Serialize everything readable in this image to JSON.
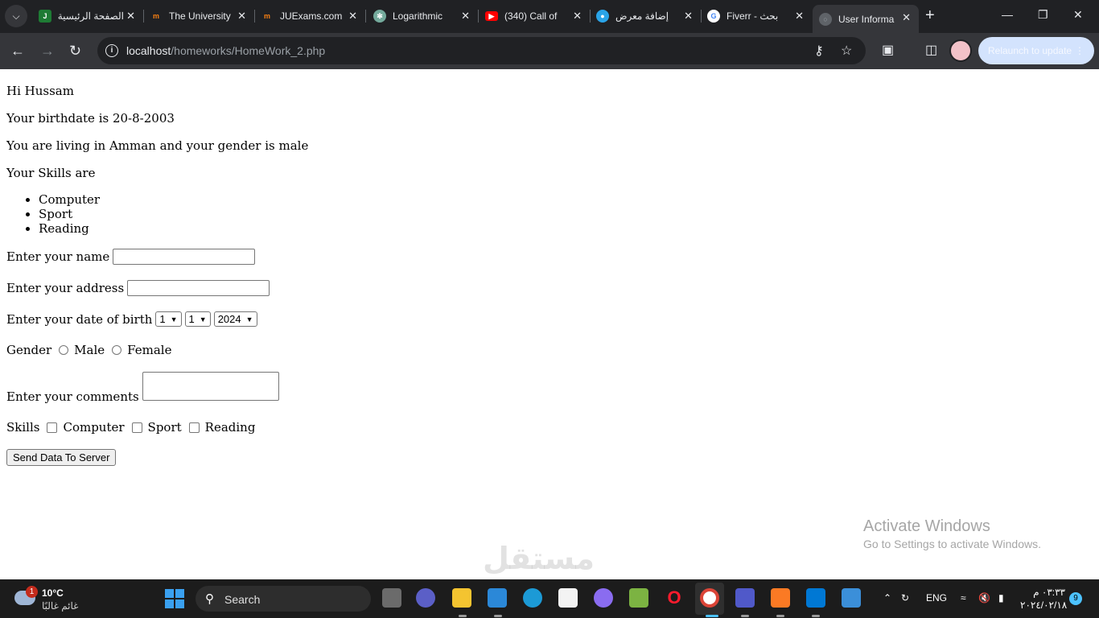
{
  "browser": {
    "tabs": [
      {
        "title": "الصفحة الرئيسية",
        "icon": "university-logo-icon"
      },
      {
        "title": "The University",
        "icon": "moodle-icon"
      },
      {
        "title": "JUExams.com",
        "icon": "moodle-icon"
      },
      {
        "title": "Logarithmic",
        "icon": "chatgpt-icon"
      },
      {
        "title": "(340) Call of",
        "icon": "youtube-icon"
      },
      {
        "title": "إضافة معرض",
        "icon": "mostaql-icon"
      },
      {
        "title": "Fiverr - بحث",
        "icon": "google-icon"
      },
      {
        "title": "User Informa",
        "icon": "globe-icon"
      }
    ],
    "url_host": "localhost",
    "url_path": "/homeworks/HomeWork_2.php",
    "relaunch_label": "Relaunch to update"
  },
  "page": {
    "greeting": "Hi Hussam",
    "birthdate_text": "Your birthdate is 20-8-2003",
    "living_text": "You are living in Amman and your gender is male",
    "skills_heading": "Your Skills are",
    "skills": [
      "Computer",
      "Sport",
      "Reading"
    ],
    "form": {
      "name_label": "Enter your name",
      "address_label": "Enter your address",
      "dob_label": "Enter your date of birth",
      "dob_day": "1",
      "dob_month": "1",
      "dob_year": "2024",
      "gender_label": "Gender",
      "gender_male": "Male",
      "gender_female": "Female",
      "comments_label": "Enter your comments",
      "skills_label": "Skills",
      "skill_computer": "Computer",
      "skill_sport": "Sport",
      "skill_reading": "Reading",
      "submit_label": "Send Data To Server"
    }
  },
  "overlay": {
    "activate_title": "Activate Windows",
    "activate_sub": "Go to Settings to activate Windows.",
    "watermark": "مستقل"
  },
  "taskbar": {
    "weather_temp": "10°C",
    "weather_cond": "غائم غالبًا",
    "weather_badge": "1",
    "search_label": "Search",
    "lang": "ENG",
    "time": "٠٣:٣٣ م",
    "date": "٢٠٢٤/٠٢/١٨",
    "notifications": "9"
  }
}
